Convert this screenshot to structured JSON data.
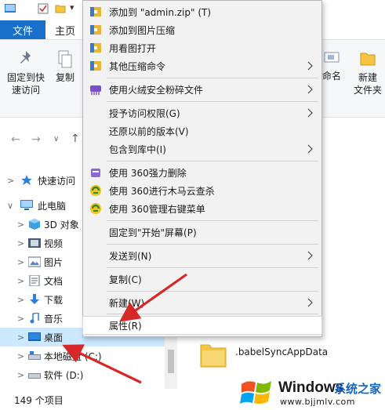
{
  "quick_access": {
    "dropdown_glyph": "▾"
  },
  "ribbon": {
    "tabs": [
      {
        "label": "文件"
      },
      {
        "label": "主页"
      }
    ],
    "buttons": {
      "pin_line1": "固定到快",
      "pin_line2": "速访问",
      "copy": "复制",
      "rename": "命名",
      "new_folder_line1": "新建",
      "new_folder_line2": "文件夹"
    }
  },
  "nav": {
    "back": "←",
    "forward": "→",
    "dropdown": "∨",
    "up": "↑"
  },
  "tree": {
    "items": [
      {
        "label": "快速访问",
        "chevron": ">",
        "icon": "star-icon"
      },
      {
        "label": "此电脑",
        "chevron": "∨",
        "icon": "computer-icon"
      },
      {
        "label": "3D 对象",
        "chevron": ">",
        "icon": "cube-icon"
      },
      {
        "label": "视频",
        "chevron": ">",
        "icon": "video-icon"
      },
      {
        "label": "图片",
        "chevron": ">",
        "icon": "picture-icon"
      },
      {
        "label": "文档",
        "chevron": ">",
        "icon": "document-icon"
      },
      {
        "label": "下载",
        "chevron": ">",
        "icon": "download-icon"
      },
      {
        "label": "音乐",
        "chevron": ">",
        "icon": "music-icon"
      },
      {
        "label": "桌面",
        "chevron": ">",
        "icon": "desktop-icon",
        "selected": true
      },
      {
        "label": "本地磁盘 (C:)",
        "chevron": ">",
        "icon": "drive-icon"
      },
      {
        "label": "软件 (D:)",
        "chevron": ">",
        "icon": "drive-icon"
      }
    ]
  },
  "content": {
    "folder_name": ".babelSyncAppData"
  },
  "status": {
    "item_count": "149 个项目"
  },
  "context_menu": {
    "items": [
      {
        "label": "添加到 \"admin.zip\" (T)",
        "icon": "archive-icon"
      },
      {
        "label": "添加到图片压缩",
        "icon": "archive-icon"
      },
      {
        "label": "用看图打开",
        "icon": "archive-icon"
      },
      {
        "label": "其他压缩命令",
        "icon": "archive-icon",
        "submenu": true
      },
      {
        "label": "使用火绒安全粉碎文件",
        "icon": "shredder-icon",
        "submenu": true
      },
      {
        "label": "授予访问权限(G)",
        "submenu": true
      },
      {
        "label": "还原以前的版本(V)"
      },
      {
        "label": "包含到库中(I)",
        "submenu": true
      },
      {
        "label": "使用 360强力删除",
        "icon": "delete-360-icon"
      },
      {
        "label": "使用 360进行木马云查杀",
        "icon": "shield-360-icon"
      },
      {
        "label": "使用 360管理右键菜单",
        "icon": "shield-360-icon"
      },
      {
        "label": "固定到\"开始\"屏幕(P)"
      },
      {
        "label": "发送到(N)",
        "submenu": true
      },
      {
        "label": "复制(C)"
      },
      {
        "label": "新建(W)",
        "submenu": true
      },
      {
        "label": "属性(R)",
        "highlighted": true
      }
    ]
  },
  "watermark": {
    "brand": "Windows",
    "suffix": "系统之家",
    "url": "www.bjjmlv.com",
    "logo_colors": [
      "#f25022",
      "#7fba00",
      "#00a4ef",
      "#ffb900"
    ]
  },
  "colors": {
    "accent": "#1a6fc8",
    "selection": "#cce8ff",
    "arrow": "#d62828"
  }
}
